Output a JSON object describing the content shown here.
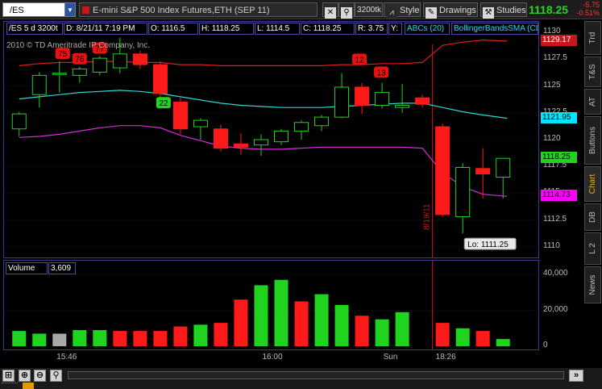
{
  "toolbar": {
    "symbol": "/ES",
    "description": "E-mini S&P 500 Index Futures,ETH (SEP 11)",
    "aggregation": "3200tk",
    "style_label": "Style",
    "drawings_label": "Drawings",
    "studies_label": "Studies",
    "last_price": "1118.25",
    "net_change": "-5.75",
    "net_change_pct": "-0.51%"
  },
  "info_bar": {
    "period": "/ES 5 d 3200t",
    "date": "D: 8/21/11 7:19 PM",
    "open": "O: 1116.5",
    "high": "H: 1118.25",
    "low": "L: 1114.5",
    "close": "C: 1118.25",
    "range": "R: 3.75",
    "y_label": "Y:",
    "abcs": "ABCs (20)",
    "bollinger": "BollingerBandsSMA (CLOS..."
  },
  "copyright": "2010 © TD Ameritrade IP Company, Inc.",
  "price_axis": {
    "ticks": [
      "1130",
      "1127.5",
      "1125",
      "1122.5",
      "1120",
      "1117.5",
      "1115",
      "1112.5",
      "1110"
    ],
    "flags": [
      {
        "label": "1129.17",
        "value": 1129.17,
        "color": "#c8171a",
        "text_color": "#ffffff"
      },
      {
        "label": "1121.95",
        "value": 1121.95,
        "color": "#00e5ff",
        "text_color": "#000000"
      },
      {
        "label": "1118.25",
        "value": 1118.25,
        "color": "#1fd31f",
        "text_color": "#000000"
      },
      {
        "label": "1114.73",
        "value": 1114.73,
        "color": "#ff00ff",
        "text_color": "#000000"
      }
    ]
  },
  "annotations": {
    "low_label": "Lo: 1111.25",
    "date_label": "8/19/11",
    "markers": [
      {
        "text": "75",
        "color": "#e81212"
      },
      {
        "text": "76",
        "color": "#e81212"
      },
      {
        "text": "77",
        "color": "#e81212"
      },
      {
        "text": "22",
        "color": "#1fd31f"
      },
      {
        "text": "12",
        "color": "#e81212"
      },
      {
        "text": "13",
        "color": "#e81212"
      }
    ]
  },
  "volume": {
    "label": "Volume",
    "value": "3,609",
    "ticks": [
      "40,000",
      "20,000",
      "0"
    ]
  },
  "time_axis": {
    "labels": [
      "15:46",
      "16:00",
      "Sun",
      "18:26"
    ]
  },
  "sidebar": {
    "tabs": [
      "Trd",
      "T&S",
      "AT",
      "Buttons",
      "Chart",
      "DB",
      "L 2",
      "News"
    ]
  },
  "chart_data": {
    "type": "candlestick",
    "ylim": [
      1109,
      1131
    ],
    "candles": [
      {
        "o": 1121.0,
        "h": 1122.6,
        "l": 1120.3,
        "c": 1122.4
      },
      {
        "o": 1124.2,
        "h": 1126.3,
        "l": 1123.0,
        "c": 1126.0
      },
      {
        "o": 1126.2,
        "h": 1127.3,
        "l": 1124.4,
        "c": 1126.2
      },
      {
        "o": 1126.0,
        "h": 1126.8,
        "l": 1125.3,
        "c": 1126.6
      },
      {
        "o": 1126.3,
        "h": 1127.8,
        "l": 1126.0,
        "c": 1127.6
      },
      {
        "o": 1126.7,
        "h": 1129.5,
        "l": 1126.2,
        "c": 1128.0
      },
      {
        "o": 1128.0,
        "h": 1128.3,
        "l": 1126.6,
        "c": 1127.0
      },
      {
        "o": 1127.0,
        "h": 1127.3,
        "l": 1123.6,
        "c": 1124.3
      },
      {
        "o": 1123.5,
        "h": 1124.0,
        "l": 1120.5,
        "c": 1121.0
      },
      {
        "o": 1121.2,
        "h": 1122.0,
        "l": 1120.0,
        "c": 1121.8
      },
      {
        "o": 1121.0,
        "h": 1121.4,
        "l": 1118.9,
        "c": 1119.2
      },
      {
        "o": 1119.6,
        "h": 1120.6,
        "l": 1118.6,
        "c": 1119.3
      },
      {
        "o": 1119.5,
        "h": 1120.5,
        "l": 1118.5,
        "c": 1120.0
      },
      {
        "o": 1119.8,
        "h": 1121.0,
        "l": 1119.5,
        "c": 1120.8
      },
      {
        "o": 1120.8,
        "h": 1121.8,
        "l": 1120.0,
        "c": 1121.6
      },
      {
        "o": 1121.3,
        "h": 1122.3,
        "l": 1120.8,
        "c": 1122.1
      },
      {
        "o": 1122.1,
        "h": 1126.2,
        "l": 1122.0,
        "c": 1124.9
      },
      {
        "o": 1124.9,
        "h": 1125.3,
        "l": 1122.4,
        "c": 1123.2
      },
      {
        "o": 1123.2,
        "h": 1125.3,
        "l": 1122.9,
        "c": 1124.4
      },
      {
        "o": 1123.0,
        "h": 1125.2,
        "l": 1122.5,
        "c": 1123.2
      },
      {
        "o": 1123.9,
        "h": 1124.2,
        "l": 1123.0,
        "c": 1123.3
      },
      {
        "o": 1121.2,
        "h": 1121.5,
        "l": 1112.8,
        "c": 1113.0
      },
      {
        "o": 1112.8,
        "h": 1117.8,
        "l": 1111.25,
        "c": 1117.4
      },
      {
        "o": 1117.3,
        "h": 1119.2,
        "l": 1114.5,
        "c": 1116.8
      },
      {
        "o": 1116.5,
        "h": 1118.25,
        "l": 1114.5,
        "c": 1118.25
      }
    ],
    "upper_band": [
      1126.9,
      1127.1,
      1127.2,
      1127.2,
      1127.3,
      1127.3,
      1127.2,
      1127.2,
      1127.0,
      1127.0,
      1126.9,
      1126.9,
      1126.9,
      1126.9,
      1126.9,
      1126.9,
      1127.0,
      1127.0,
      1127.1,
      1127.1,
      1127.2,
      1128.8,
      1129.1,
      1129.3,
      1129.2
    ],
    "middle_band": [
      1123.8,
      1124.0,
      1124.2,
      1124.4,
      1124.5,
      1124.6,
      1124.5,
      1124.3,
      1124.0,
      1123.7,
      1123.4,
      1123.2,
      1123.1,
      1123.0,
      1123.0,
      1123.0,
      1123.1,
      1123.2,
      1123.3,
      1123.4,
      1123.4,
      1123.0,
      1122.6,
      1122.3,
      1122.0
    ],
    "lower_band": [
      1120.2,
      1120.3,
      1120.5,
      1120.8,
      1121.1,
      1121.3,
      1121.3,
      1121.1,
      1120.4,
      1119.9,
      1119.4,
      1119.2,
      1119.1,
      1119.1,
      1119.2,
      1119.3,
      1119.3,
      1119.3,
      1119.3,
      1119.3,
      1119.2,
      1116.9,
      1115.6,
      1114.9,
      1114.7
    ],
    "volume": [
      8500,
      7000,
      7000,
      9000,
      9000,
      8500,
      8500,
      8500,
      11000,
      12000,
      13000,
      26000,
      34000,
      37000,
      25000,
      29000,
      23000,
      17000,
      15000,
      19000,
      0,
      13000,
      10000,
      8500,
      4000
    ],
    "volume_colors": [
      "g",
      "g",
      "n",
      "g",
      "g",
      "r",
      "r",
      "r",
      "r",
      "g",
      "r",
      "r",
      "g",
      "g",
      "r",
      "g",
      "g",
      "r",
      "g",
      "g",
      "n",
      "r",
      "g",
      "r",
      "g"
    ],
    "volume_ylim": [
      0,
      45000
    ]
  }
}
